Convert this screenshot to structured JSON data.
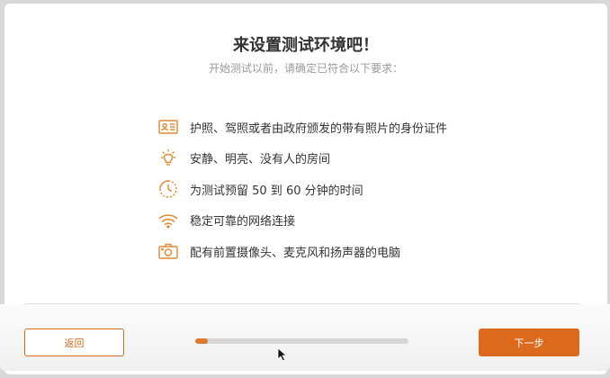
{
  "colors": {
    "accent": "#dc6a1d",
    "title_text": "#333333",
    "subtitle_text": "#9a9a9a"
  },
  "header": {
    "title": "来设置测试环境吧！",
    "subtitle": "开始测试以前，请确定已符合以下要求："
  },
  "requirements": [
    {
      "icon": "id-card-icon",
      "label": "护照、驾照或者由政府颁发的带有照片的身份证件"
    },
    {
      "icon": "light-bulb-icon",
      "label": "安静、明亮、没有人的房间"
    },
    {
      "icon": "timer-icon",
      "label": "为测试预留 50 到 60 分钟的时间"
    },
    {
      "icon": "wifi-icon",
      "label": "稳定可靠的网络连接"
    },
    {
      "icon": "camera-icon",
      "label": "配有前置摄像头、麦克风和扬声器的电脑"
    }
  ],
  "footer": {
    "back_label": "返回",
    "next_label": "下一步",
    "progress_fraction": 0.06
  }
}
